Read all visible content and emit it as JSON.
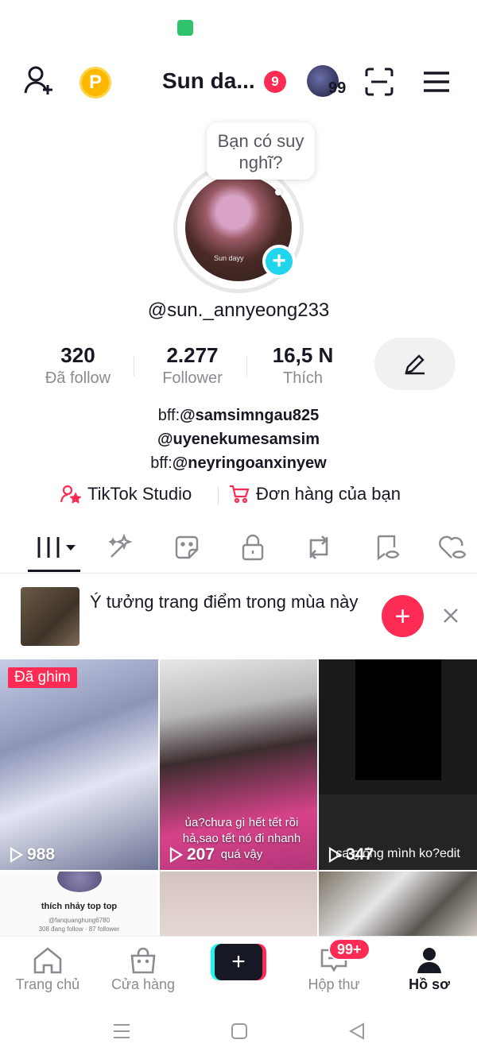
{
  "header": {
    "title": "Sun da...",
    "notification_count": "9",
    "story_count": "99",
    "coin_label": "P"
  },
  "profile": {
    "tooltip": "Bạn có suy nghĩ?",
    "avatar_caption": "Sun dayy",
    "handle": "@sun._annyeong233",
    "stats": [
      {
        "value": "320",
        "label": "Đã follow"
      },
      {
        "value": "2.277",
        "label": "Follower"
      },
      {
        "value": "16,5 N",
        "label": "Thích"
      }
    ],
    "bio": [
      {
        "prefix": "bff:",
        "mention": "@samsimngau825"
      },
      {
        "prefix": "",
        "mention": "@uyenekumesamsim"
      },
      {
        "prefix": "bff:",
        "mention": "@neyringoanxinyew"
      }
    ],
    "links": {
      "studio": "TikTok Studio",
      "orders": "Đơn hàng của bạn"
    }
  },
  "promo": {
    "text": "Ý tưởng trang điểm trong mùa này"
  },
  "videos": [
    {
      "badge": "Đã ghim",
      "views": "988"
    },
    {
      "caption": "ủa?chưa gì hết tết rồi hả,sao tết nó đi nhanh quá vậy",
      "views": "207"
    },
    {
      "caption": "ca giống mình ko?edit",
      "views": "347"
    },
    {
      "title": "thích nhảy top top",
      "subtitle": "@fanquanghung6780",
      "meta": "308 đang follow · 87 follower"
    }
  ],
  "bottom_nav": {
    "home": "Trang chủ",
    "shop": "Cửa hàng",
    "inbox": "Hộp thư",
    "inbox_badge": "99+",
    "profile": "Hồ sơ"
  },
  "colors": {
    "accent": "#fe2c55",
    "cyan": "#25f4ee",
    "text": "#161823",
    "muted": "#8a8b91"
  }
}
